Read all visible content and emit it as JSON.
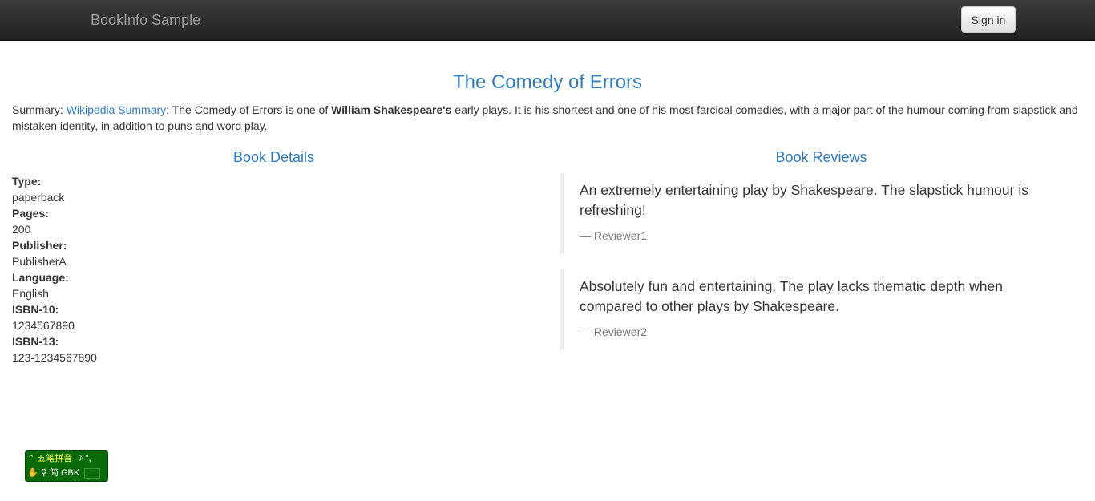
{
  "navbar": {
    "brand": "BookInfo Sample",
    "sign_in_label": "Sign in"
  },
  "book": {
    "title": "The Comedy of Errors",
    "summary_prefix": "Summary: ",
    "summary_link": "Wikipedia Summary",
    "summary_text_1": ": The Comedy of Errors is one of ",
    "summary_bold": "William Shakespeare's",
    "summary_text_2": " early plays. It is his shortest and one of his most farcical comedies, with a major part of the humour coming from slapstick and mistaken identity, in addition to puns and word play."
  },
  "details": {
    "heading": "Book Details",
    "items": [
      {
        "key": "Type:",
        "value": "paperback"
      },
      {
        "key": "Pages:",
        "value": "200"
      },
      {
        "key": "Publisher:",
        "value": "PublisherA"
      },
      {
        "key": "Language:",
        "value": "English"
      },
      {
        "key": "ISBN-10:",
        "value": "1234567890"
      },
      {
        "key": "ISBN-13:",
        "value": "123-1234567890"
      }
    ]
  },
  "reviews": {
    "heading": "Book Reviews",
    "items": [
      {
        "text": "An extremely entertaining play by Shakespeare. The slapstick humour is refreshing!",
        "reviewer": "— Reviewer1"
      },
      {
        "text": "Absolutely fun and entertaining. The play lacks thematic depth when compared to other plays by Shakespeare.",
        "reviewer": "— Reviewer2"
      }
    ]
  },
  "ime_toolbar": {
    "mode_label": "五笔拼音",
    "charset_label": "简 GBK"
  }
}
